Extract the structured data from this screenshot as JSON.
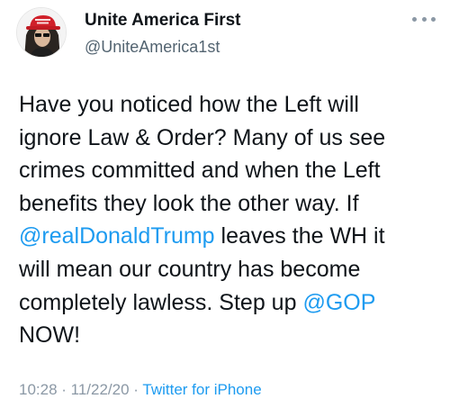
{
  "author": {
    "name": "Unite America First",
    "handle": "@UniteAmerica1st",
    "avatar_icon": "profile-photo-red-hat"
  },
  "more_icon": "ellipsis-icon",
  "tweet": {
    "line1": "Have you noticed how the Left will",
    "line2": "ignore Law & Order?  Many of us see",
    "line3": "crimes committed and when the Left",
    "line4": "benefits they look the other way. If",
    "mention1": "@realDonaldTrump",
    "line5_after": " leaves the WH it",
    "line6": "will mean our country has become",
    "line7_before": "completely lawless. Step up ",
    "mention2": "@GOP",
    "line8": "NOW!"
  },
  "meta": {
    "time": "10:28",
    "separator": " · ",
    "date": "11/22/20",
    "source": "Twitter for iPhone"
  },
  "colors": {
    "link": "#1d9bf0",
    "text": "#0f1419",
    "secondary": "#536471"
  }
}
